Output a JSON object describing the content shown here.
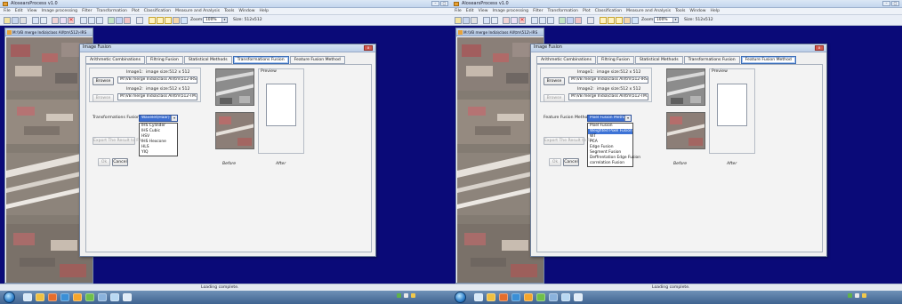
{
  "app": {
    "title": "AlosearsProcess v1.0",
    "menu": [
      "File",
      "Edit",
      "View",
      "Image processing",
      "Filter",
      "Transformation",
      "Plot",
      "Classification",
      "Measure and Analysis",
      "Tools",
      "Window",
      "Help"
    ],
    "zoom_label": "Zoom:",
    "zoom_value": "100%",
    "size_label": "Size: 512x512",
    "status": "Loading complete."
  },
  "image_window": {
    "title": "M:\\VB merge India\\class All\\tm\\512\\-IRS"
  },
  "dialog": {
    "title": "Image Fusion",
    "close": "x",
    "tabs": [
      "Arithmetic Combinations",
      "Filtring Fusion",
      "Statistical Methods",
      "Transformations Fusion",
      "Feature Fusion Method"
    ],
    "image1_label": "Image1:",
    "image1_size": "image size:512 x 512",
    "image1_path": "M:\\VB merge India\\class All\\tm\\512-IRS",
    "image2_label": "Image2:",
    "image2_size": "image size:512 x 512",
    "image2_path": "M:\\VB merge India\\class All\\tm\\512-TM.BMP",
    "browse": "Browse",
    "export": "Export The Result to File...",
    "ok": "Ok",
    "cancel": "Cancel",
    "preview": "Preview",
    "before": "Before",
    "after": "After"
  },
  "left_panel": {
    "active_tab": "Transformations Fusion",
    "method_label": "Transformations Fusion",
    "selected": "Wavelet(Haar)",
    "options": [
      "Wavelet(Haar)",
      "IHS Cylinder",
      "IHS Cubic",
      "HSV",
      "IHS Hexcone",
      "HLS",
      "YIQ"
    ]
  },
  "right_panel": {
    "active_tab": "Feature Fusion Method",
    "method_label": "Feature Fusion Method",
    "selected": "Pixel Fusion Method",
    "options": [
      "Pixel Fusion",
      "Weighted Pixel Fusion",
      "WT",
      "PCA",
      "Edge Fusion",
      "Segment Fusion",
      "Deffrentation Edge Fusion",
      "correlation Fusion"
    ]
  },
  "colors": {
    "desktop": "#0a0a78",
    "selection": "#3d73d6",
    "active_tab": "#3d6fb8"
  }
}
